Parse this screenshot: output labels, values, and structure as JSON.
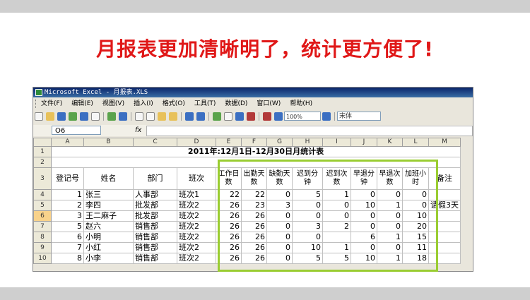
{
  "headline": "月报表更加清晰明了，统计更方便了!",
  "window": {
    "title": "Microsoft Excel - 月报表.XLS"
  },
  "menu": [
    "文件(F)",
    "编辑(E)",
    "视图(V)",
    "插入(I)",
    "格式(O)",
    "工具(T)",
    "数据(D)",
    "窗口(W)",
    "帮助(H)"
  ],
  "toolbar": {
    "zoom": "100%",
    "font": "宋体"
  },
  "formula_bar": {
    "cell_ref": "O6",
    "fx": "fx"
  },
  "sheet": {
    "col_letters": [
      "A",
      "B",
      "C",
      "D",
      "E",
      "F",
      "G",
      "H",
      "I",
      "J",
      "K",
      "L",
      "M"
    ],
    "title": "2011年:12月1日-12月30日月统计表",
    "headers": [
      "登记号",
      "姓名",
      "部门",
      "班次",
      "工作日数",
      "出勤天数",
      "缺勤天数",
      "迟到分钟",
      "迟到次数",
      "早退分钟",
      "早退次数",
      "加班小时",
      "备注"
    ],
    "rows": [
      {
        "rn": "4",
        "cells": [
          "1",
          "张三",
          "人事部",
          "班次1",
          "22",
          "22",
          "0",
          "5",
          "1",
          "0",
          "0",
          "0",
          ""
        ]
      },
      {
        "rn": "5",
        "cells": [
          "2",
          "李四",
          "批发部",
          "班次2",
          "26",
          "23",
          "3",
          "0",
          "0",
          "10",
          "1",
          "0",
          "请假3天"
        ]
      },
      {
        "rn": "6",
        "cells": [
          "3",
          "王二麻子",
          "批发部",
          "班次2",
          "26",
          "26",
          "0",
          "0",
          "0",
          "0",
          "0",
          "10",
          ""
        ]
      },
      {
        "rn": "7",
        "cells": [
          "5",
          "赵六",
          "销售部",
          "班次2",
          "26",
          "26",
          "0",
          "3",
          "2",
          "0",
          "0",
          "20",
          ""
        ]
      },
      {
        "rn": "8",
        "cells": [
          "6",
          "小明",
          "销售部",
          "班次2",
          "26",
          "26",
          "0",
          "0",
          "",
          "6",
          "1",
          "15",
          ""
        ]
      },
      {
        "rn": "9",
        "cells": [
          "7",
          "小红",
          "销售部",
          "班次2",
          "26",
          "26",
          "0",
          "10",
          "1",
          "0",
          "0",
          "11",
          ""
        ]
      },
      {
        "rn": "10",
        "cells": [
          "8",
          "小李",
          "销售部",
          "班次2",
          "26",
          "26",
          "0",
          "5",
          "5",
          "10",
          "1",
          "18",
          ""
        ]
      }
    ]
  }
}
